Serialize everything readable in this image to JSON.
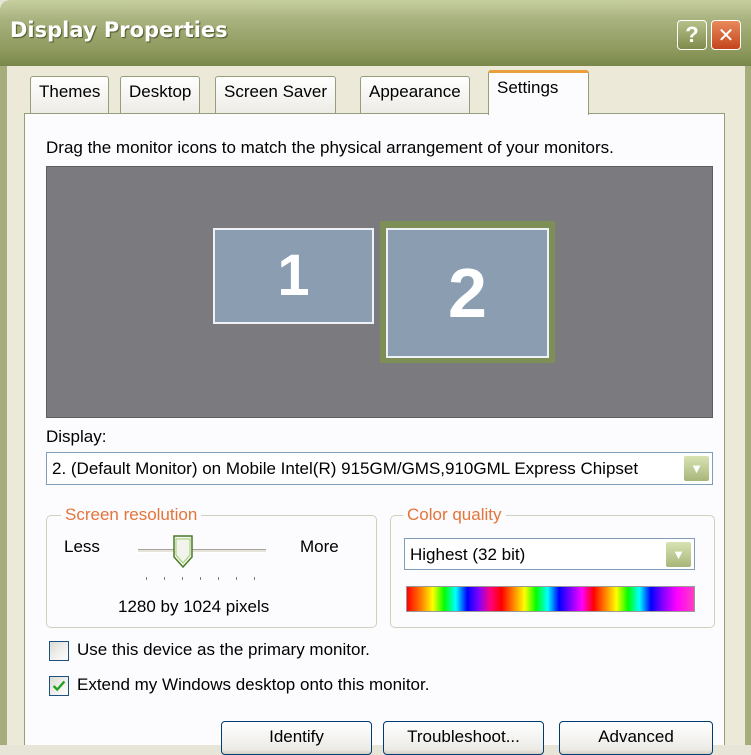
{
  "window": {
    "title": "Display Properties",
    "help_label": "?",
    "close_label": "✕"
  },
  "tabs": [
    {
      "label": "Themes"
    },
    {
      "label": "Desktop"
    },
    {
      "label": "Screen Saver"
    },
    {
      "label": "Appearance"
    },
    {
      "label": "Settings",
      "active": true
    }
  ],
  "settings": {
    "instruction": "Drag the monitor icons to match the physical arrangement of your monitors.",
    "monitors": [
      {
        "label": "1"
      },
      {
        "label": "2",
        "selected": true
      }
    ],
    "display_label": "Display:",
    "display_value": "2. (Default Monitor) on Mobile Intel(R) 915GM/GMS,910GML Express Chipset",
    "screen_resolution": {
      "legend": "Screen resolution",
      "less_label": "Less",
      "more_label": "More",
      "value_text": "1280 by 1024 pixels",
      "slider_position": 0.35
    },
    "color_quality": {
      "legend": "Color quality",
      "value": "Highest (32 bit)"
    },
    "checkboxes": [
      {
        "label": "Use this device as the primary monitor.",
        "checked": false
      },
      {
        "label": "Extend my Windows desktop onto this monitor.",
        "checked": true
      }
    ],
    "buttons": {
      "identify": "Identify",
      "troubleshoot": "Troubleshoot...",
      "advanced": "Advanced"
    }
  },
  "colors": {
    "title_bar": "#8e9a5e",
    "tab_highlight": "#e9a03b",
    "group_legend": "#e3743a",
    "monitor_fill": "#8a9db1",
    "monitor_area": "#7b7a7e",
    "selected_monitor_border": "#7d8f56"
  }
}
